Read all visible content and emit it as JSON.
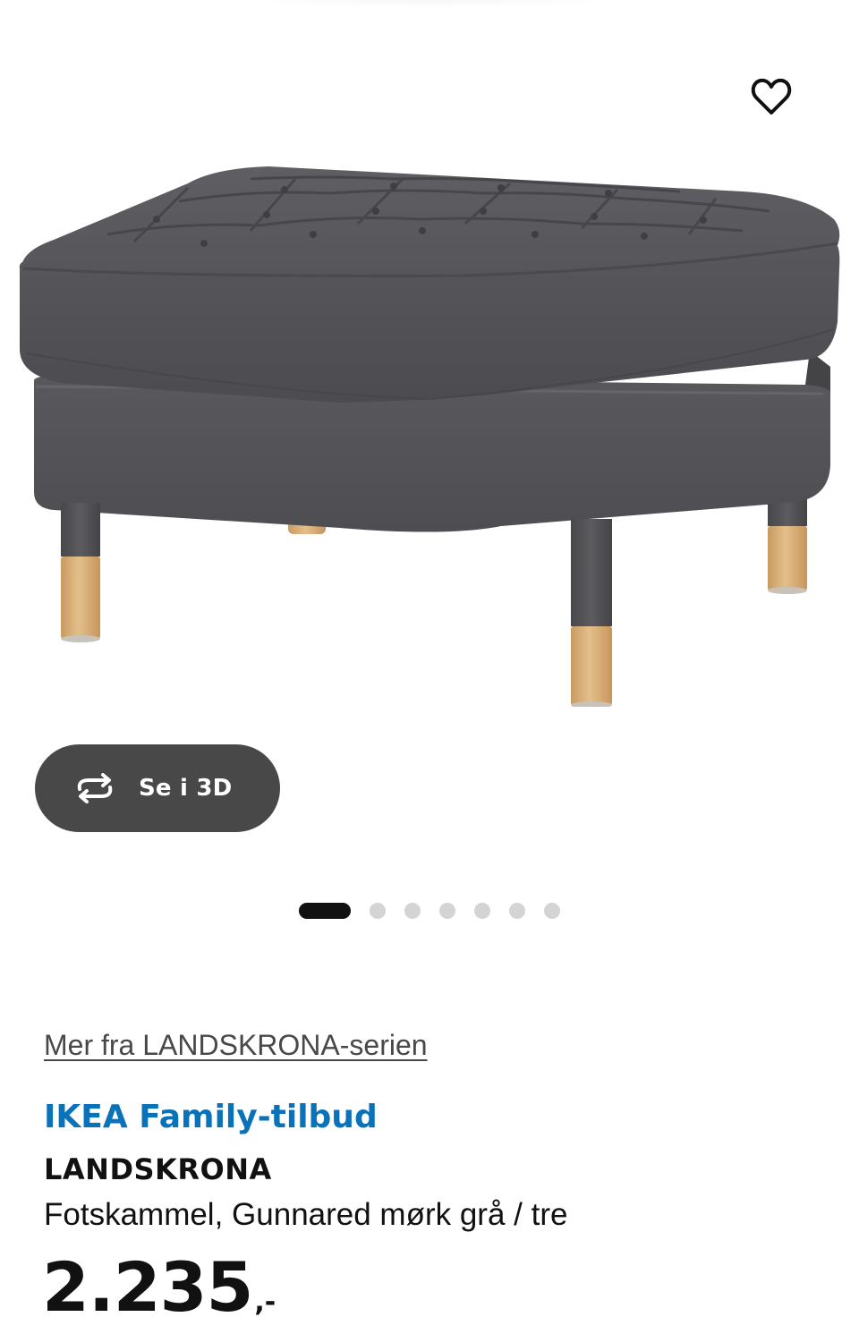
{
  "product_gallery": {
    "image_alt": "LANDSKRONA fotskammel",
    "view_3d_label": "Se i 3D",
    "carousel": {
      "total": 7,
      "active_index": 0
    },
    "icons": {
      "favorite": "heart-outline-icon",
      "view_3d": "rotate-3d-icon"
    }
  },
  "product_info": {
    "series_link": "Mer fra LANDSKRONA-serien",
    "offer_label": "IKEA Family-tilbud",
    "name": "LANDSKRONA",
    "description": "Fotskammel, Gunnared mørk grå / tre",
    "price": "2.235",
    "price_suffix": ",-"
  },
  "colors": {
    "offer_blue": "#0a72b8",
    "button_dark": "#484848",
    "dot_inactive": "#d4d4d4",
    "dot_active": "#111111",
    "fabric": "#57575a",
    "wood": "#d9b07a"
  }
}
